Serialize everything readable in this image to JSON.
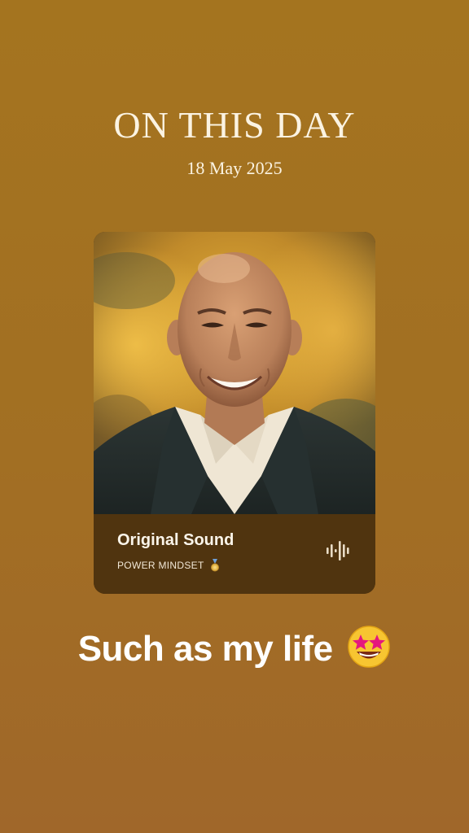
{
  "header": {
    "title": "ON THIS DAY",
    "date": "18 May 2025"
  },
  "card": {
    "image_description": "portrait-photo",
    "sound_title": "Original Sound",
    "artist": "POWER MINDSET",
    "artist_icon": "medal-icon",
    "action_icon": "sound-wave-icon"
  },
  "caption": {
    "text": "Such as my life",
    "emoji": "star-struck-emoji"
  },
  "colors": {
    "background": "#a4741f",
    "card_footer": "#50340f",
    "text_light": "#fbf3e2"
  }
}
